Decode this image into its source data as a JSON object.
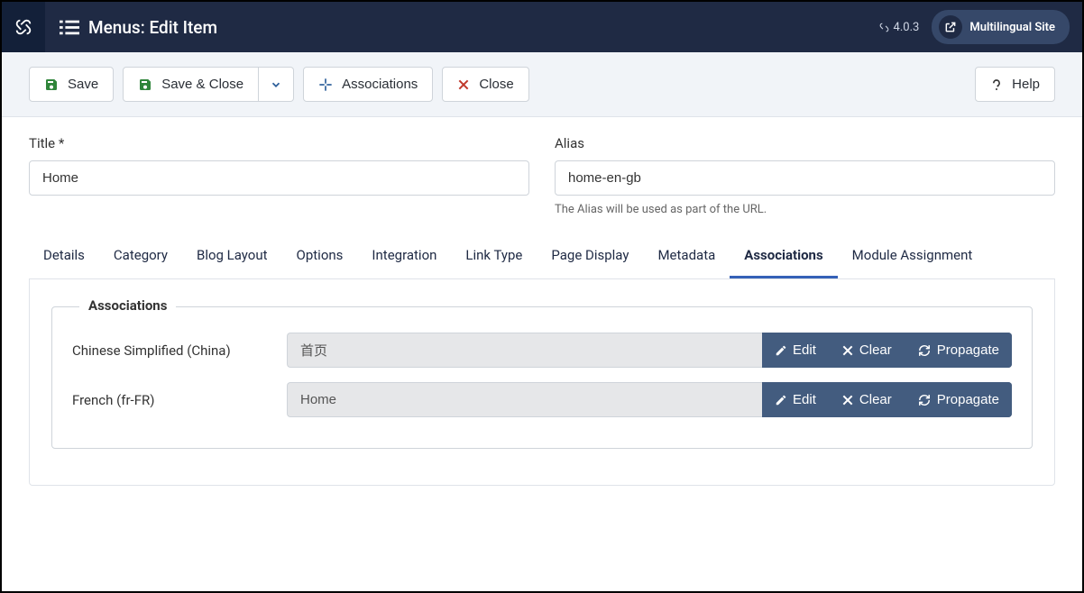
{
  "header": {
    "page_title": "Menus: Edit Item",
    "version": "4.0.3",
    "site_label": "Multilingual Site"
  },
  "toolbar": {
    "save": "Save",
    "save_close": "Save & Close",
    "associations": "Associations",
    "close": "Close",
    "help": "Help"
  },
  "form": {
    "title_label": "Title *",
    "title_value": "Home",
    "alias_label": "Alias",
    "alias_value": "home-en-gb",
    "alias_hint": "The Alias will be used as part of the URL."
  },
  "tabs": [
    {
      "label": "Details",
      "active": false
    },
    {
      "label": "Category",
      "active": false
    },
    {
      "label": "Blog Layout",
      "active": false
    },
    {
      "label": "Options",
      "active": false
    },
    {
      "label": "Integration",
      "active": false
    },
    {
      "label": "Link Type",
      "active": false
    },
    {
      "label": "Page Display",
      "active": false
    },
    {
      "label": "Metadata",
      "active": false
    },
    {
      "label": "Associations",
      "active": true
    },
    {
      "label": "Module Assignment",
      "active": false
    }
  ],
  "associations": {
    "legend": "Associations",
    "rows": [
      {
        "lang_label": "Chinese Simplified (China)",
        "value": "首页"
      },
      {
        "lang_label": "French (fr-FR)",
        "value": "Home"
      }
    ],
    "edit": "Edit",
    "clear": "Clear",
    "propagate": "Propagate"
  }
}
